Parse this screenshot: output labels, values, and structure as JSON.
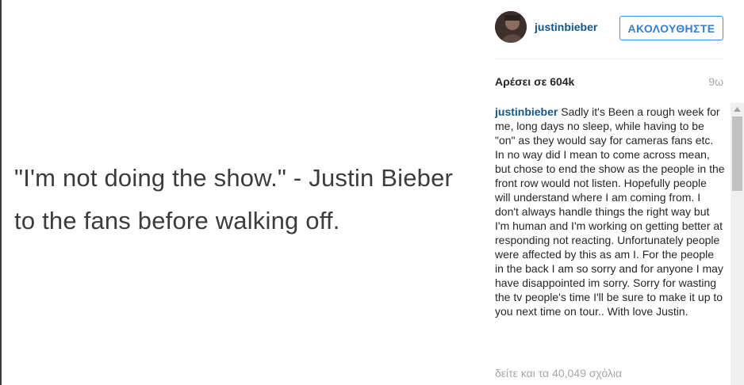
{
  "post": {
    "quote_text": "\"I'm not doing the show.\" - Justin Bieber to the fans before walking off."
  },
  "header": {
    "username": "justinbieber",
    "follow_label": "ΑΚΟΛΟΥΘΗΣΤΕ"
  },
  "stats": {
    "likes": "Αρέσει σε 604k",
    "time": "9ω"
  },
  "caption": {
    "username": "justinbieber",
    "text": "Sadly it's Been a rough week for me, long days no sleep, while having to be \"on\" as they would say for cameras fans etc. In no way did I mean to come across mean, but chose to end the show as the people in the front row would not listen. Hopefully people will understand where I am coming from. I don't always handle things the right way but I'm human and I'm working on getting better at responding not reacting. Unfortunately people were affected by this as am I. For the people in the back I am so sorry and for anyone I may have disappointed im sorry. Sorry for wasting the tv people's time I'll be sure to make it up to you next time on tour.. With love Justin."
  },
  "comments": {
    "view_all": "δείτε και τα 40,049 σχόλια"
  },
  "colors": {
    "link_blue": "#125688",
    "follow_blue": "#2f7ed8",
    "muted_gray": "#a5a7aa"
  },
  "icons": {
    "scroll_up": "scroll-up-arrow-icon",
    "avatar": "avatar"
  }
}
